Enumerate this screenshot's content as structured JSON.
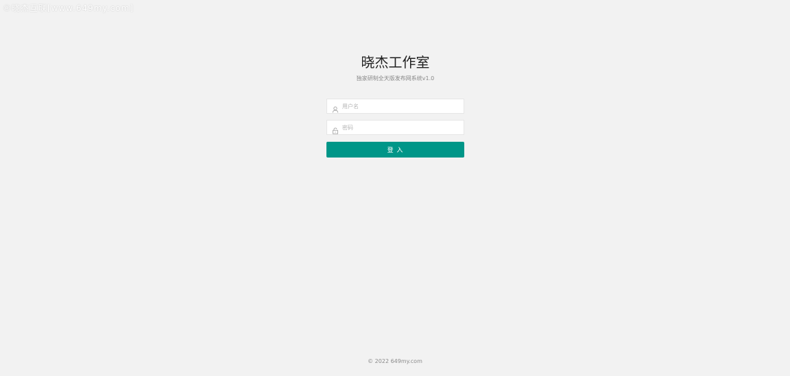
{
  "watermark": "®晓杰互联[www.649my.com]",
  "login": {
    "title": "晓杰工作室",
    "subtitle": "独家研制全天版发布网系统v1.0",
    "username": {
      "placeholder": "用户名",
      "icon": "user-icon"
    },
    "password": {
      "placeholder": "密码",
      "icon": "lock-icon"
    },
    "submit_label": "登 入"
  },
  "footer": {
    "text": "© 2022  649my.com"
  },
  "colors": {
    "background": "#f2f2f2",
    "accent": "#009688"
  }
}
